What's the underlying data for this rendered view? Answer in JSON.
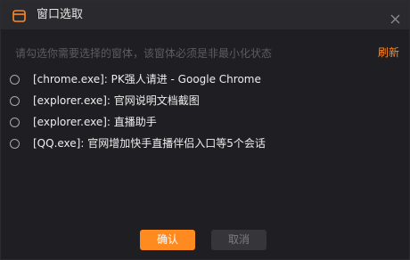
{
  "dialog": {
    "title": "窗口选取",
    "close_icon": "close-icon",
    "title_icon": "window-icon"
  },
  "hint": "请勾选你需要选择的窗体，该窗体必须是非最小化状态",
  "refresh_label": "刷新",
  "windows": [
    {
      "label": "[chrome.exe]: PK强人请进 - Google Chrome",
      "selected": false
    },
    {
      "label": "[explorer.exe]: 官网说明文档截图",
      "selected": false
    },
    {
      "label": "[explorer.exe]: 直播助手",
      "selected": false
    },
    {
      "label": "[QQ.exe]: 官网增加快手直播伴侣入口等5个会话",
      "selected": false
    }
  ],
  "buttons": {
    "confirm_label": "确认",
    "cancel_label": "取消"
  },
  "colors": {
    "accent": "#ff8a1f",
    "background": "#1f1f23",
    "titlebar": "#2a2a2e",
    "hint_text": "#5b5b62",
    "disabled_button": "#35353a"
  }
}
